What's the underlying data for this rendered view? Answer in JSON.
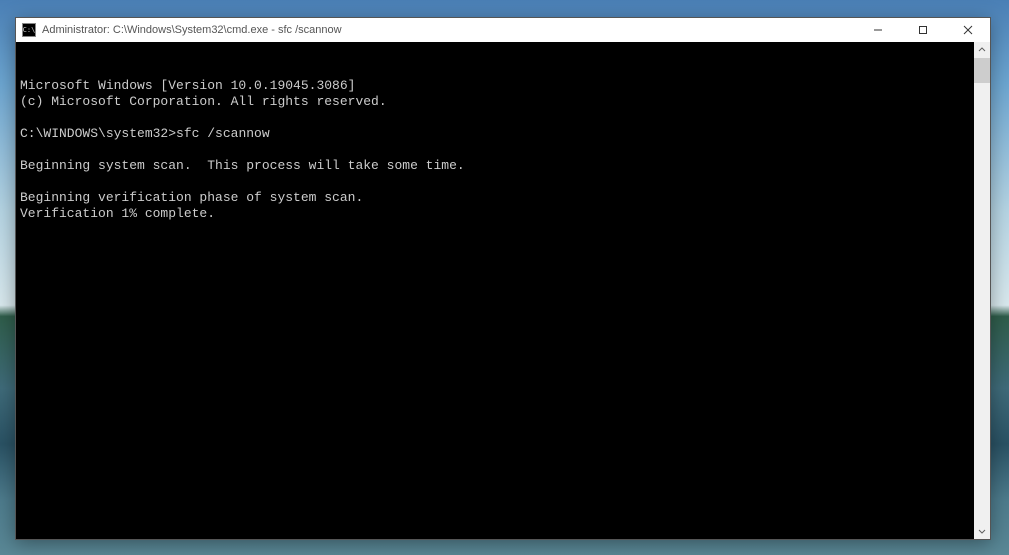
{
  "window": {
    "title": "Administrator: C:\\Windows\\System32\\cmd.exe - sfc  /scannow",
    "icon_label": "cmd-icon"
  },
  "controls": {
    "minimize": "─",
    "maximize": "☐",
    "close": "✕"
  },
  "terminal": {
    "line1": "Microsoft Windows [Version 10.0.19045.3086]",
    "line2": "(c) Microsoft Corporation. All rights reserved.",
    "blank1": "",
    "prompt": "C:\\WINDOWS\\system32>",
    "command": "sfc /scannow",
    "blank2": "",
    "line3": "Beginning system scan.  This process will take some time.",
    "blank3": "",
    "line4": "Beginning verification phase of system scan.",
    "line5": "Verification 1% complete."
  }
}
